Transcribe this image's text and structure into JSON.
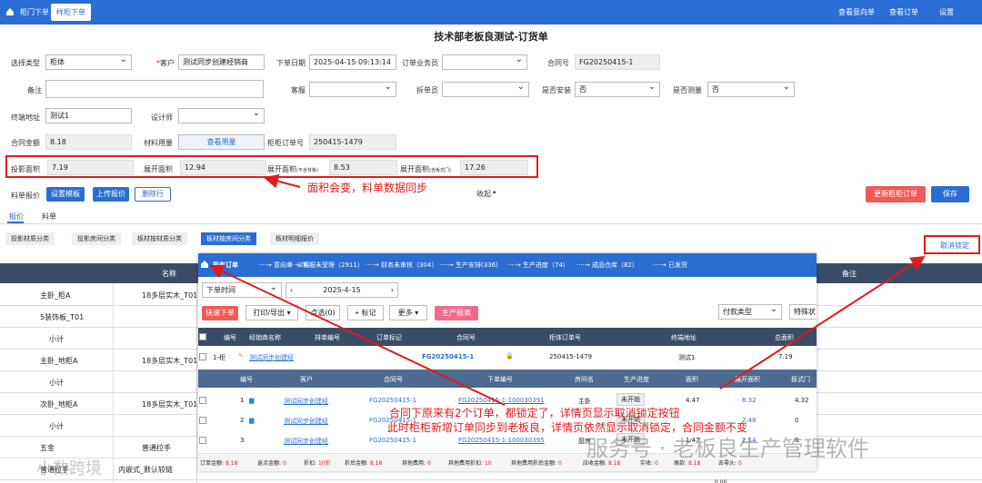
{
  "topbar": {
    "tabs": [
      "柜门下单",
      "样柜下单"
    ],
    "right_links": [
      "查看意向单",
      "查看订单",
      "设置"
    ]
  },
  "page_title": "技术部老板良测试-订货单",
  "form": {
    "select_type_label": "选择类型",
    "select_type_value": "柜体",
    "customer_label": "客户",
    "customer_required": "*",
    "customer_value": "测试同步创建经销商",
    "order_date_label": "下单日期",
    "order_date_value": "2025-04-15 09:13:14",
    "salesman_label": "订单业务员",
    "contract_label": "合同号",
    "contract_value": "FG20250415-1",
    "remark_label": "备注",
    "service_label": "客服",
    "splitter_label": "拆单员",
    "need_install_label": "是否安装",
    "need_install_value": "否",
    "need_measure_label": "是否测量",
    "need_measure_value": "否",
    "terminal_label": "终端地址",
    "terminal_value": "测试1",
    "designer_label": "设计师",
    "amount_label": "合同金额",
    "amount_value": "8.18",
    "material_label": "材料用量",
    "material_btn": "查看用量",
    "cabinet_no_label": "柜柜订单号",
    "cabinet_no_value": "250415-1479",
    "proj_area_label": "投影面积",
    "proj_area_value": "7.19",
    "unfold_area_label": "展开面积",
    "unfold_area_value": "12.94",
    "unfold_area2_label": "展开面积",
    "unfold_area2_note": "(不含背板)",
    "unfold_area2_value": "8.53",
    "unfold_area3_label": "展开面积",
    "unfold_area3_note": "(含板式门)",
    "unfold_area3_value": "17.26"
  },
  "toolbar": {
    "quote_label": "料单报价",
    "set_template": "设置模板",
    "upload_quote": "上传报价",
    "delete_row": "删除行",
    "collapse": "收起",
    "update_order": "更新柜柜订单",
    "save": "保存",
    "cancel_lock": "取消锁定"
  },
  "tabs2": [
    "报价",
    "料单"
  ],
  "segments": [
    "投影材质分类",
    "投影房间分类",
    "板材按材质分类",
    "板材按房间分类",
    "板材明细报价"
  ],
  "grid": {
    "col_name": "名称",
    "col_remark": "备注",
    "rows": [
      {
        "a": "主卧_柜A",
        "b": "18多层实木_T01"
      },
      {
        "a": "5装饰板_T01",
        "b": ""
      },
      {
        "a": "小计",
        "b": ""
      },
      {
        "a": "主卧_地柜A",
        "b": "18多层实木_T01"
      },
      {
        "a": "小计",
        "b": ""
      },
      {
        "a": "次卧_地柜A",
        "b": "18多层实木_T01"
      },
      {
        "a": "小计",
        "b": ""
      },
      {
        "a": "五金",
        "b": "普通拉手"
      },
      {
        "a": "普通拉手",
        "b": "内嵌式_默认较链"
      },
      {
        "a": "小计",
        "b": ""
      }
    ],
    "bottom_value": "0.00"
  },
  "popup": {
    "pipeline": [
      "所有订单",
      "意向单（28）",
      "客服未受理（2911）",
      "财务未审核（304）",
      "生产安排(336)",
      "生产进度（74）",
      "成品仓库（82）",
      "已发货"
    ],
    "filter_time": "下单时间",
    "filter_date": "2025-4-15",
    "pay_type": "付款类型",
    "special": "特殊状",
    "buttons": [
      "快速下单",
      "打印/导出",
      "点选(0)",
      "标记",
      "更多",
      "生产报表"
    ],
    "table_head": [
      "编号",
      "经销商名称",
      "排单编号",
      "订单标记",
      "合同号",
      "柜体订单号",
      "终端地址",
      "总面积"
    ],
    "row": {
      "no": "1-柜",
      "dealer": "测试同步创建经",
      "contract": "FG20250415-1",
      "cab_no": "250415-1479",
      "addr": "测试1",
      "area": "7.19"
    },
    "sub_head": [
      "编号",
      "客户",
      "合同号",
      "下单编号",
      "房间名",
      "生产进度",
      "面积",
      "展开面积",
      "板式门"
    ],
    "sub_rows": [
      {
        "no": "1",
        "cust": "测试同步创建经",
        "contract": "FG20250415-1",
        "order": "FG20250415-1-100030391",
        "room": "主卧",
        "prog": "未开始",
        "area": "4.47",
        "unf": "8.32",
        "door": "4.32"
      },
      {
        "no": "2",
        "cust": "测试同步创建经",
        "contract": "FG20250415-1",
        "order": "",
        "room": "",
        "prog": "未开始",
        "area": "",
        "unf": "2.48",
        "door": "0"
      },
      {
        "no": "3",
        "cust": "测试同步创建经",
        "contract": "FG20250415-1",
        "order": "FG20250415-1-100030395",
        "room": "厨房",
        "prog": "未开始",
        "area": "1.47",
        "unf": "2.14",
        "door": "0"
      }
    ],
    "footer": [
      [
        "订单金额:",
        "8.18"
      ],
      [
        "返点金额:",
        "0"
      ],
      [
        "折扣:",
        "10折"
      ],
      [
        "折后金额:",
        "8.18"
      ],
      [
        "其他费用:",
        "0"
      ],
      [
        "其他费用折扣:",
        "10"
      ],
      [
        "其他费用折后金额:",
        "0"
      ],
      [
        "应收金额:",
        "8.18"
      ],
      [
        "实收:",
        "0"
      ],
      [
        "尾款:",
        "8.18"
      ],
      [
        "去零头:",
        "0"
      ]
    ]
  },
  "annotations": {
    "area": "面积会变，料单数据同步",
    "main1": "合同下原来有2个订单，都锁定了，详情页显示取消锁定按钮",
    "main2": "此时柜柜新增订单同步到老板良，详情页依然显示取消锁定，合同金额不变"
  },
  "watermark": {
    "left": "小数跨境",
    "right": "服务号 · 老板良生产管理软件"
  },
  "colors": {
    "brand": "#2a6ed4",
    "annotation": "#e21a1a",
    "danger": "#ef5b56"
  }
}
